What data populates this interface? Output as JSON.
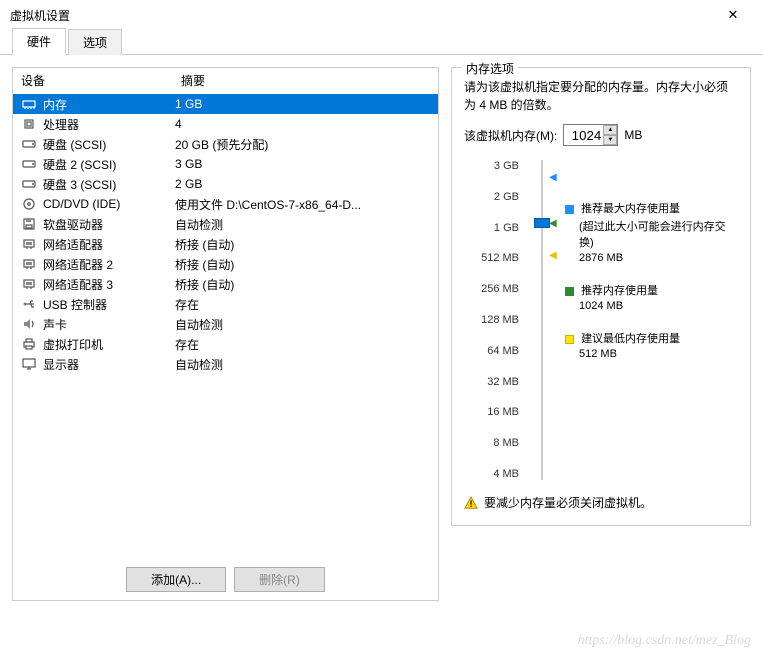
{
  "window": {
    "title": "虚拟机设置"
  },
  "tabs": {
    "hardware": "硬件",
    "options": "选项"
  },
  "headers": {
    "device": "设备",
    "summary": "摘要"
  },
  "devices": [
    {
      "name": "内存",
      "summary": "1 GB",
      "icon": "memory",
      "selected": true
    },
    {
      "name": "处理器",
      "summary": "4",
      "icon": "cpu"
    },
    {
      "name": "硬盘 (SCSI)",
      "summary": "20 GB (预先分配)",
      "icon": "disk"
    },
    {
      "name": "硬盘 2 (SCSI)",
      "summary": "3 GB",
      "icon": "disk"
    },
    {
      "name": "硬盘 3 (SCSI)",
      "summary": "2 GB",
      "icon": "disk"
    },
    {
      "name": "CD/DVD (IDE)",
      "summary": "使用文件 D:\\CentOS-7-x86_64-D...",
      "icon": "cd"
    },
    {
      "name": "软盘驱动器",
      "summary": "自动检测",
      "icon": "floppy"
    },
    {
      "name": "网络适配器",
      "summary": "桥接 (自动)",
      "icon": "net"
    },
    {
      "name": "网络适配器 2",
      "summary": "桥接 (自动)",
      "icon": "net"
    },
    {
      "name": "网络适配器 3",
      "summary": "桥接 (自动)",
      "icon": "net"
    },
    {
      "name": "USB 控制器",
      "summary": "存在",
      "icon": "usb"
    },
    {
      "name": "声卡",
      "summary": "自动检测",
      "icon": "sound"
    },
    {
      "name": "虚拟打印机",
      "summary": "存在",
      "icon": "printer"
    },
    {
      "name": "显示器",
      "summary": "自动检测",
      "icon": "display"
    }
  ],
  "memopt": {
    "title": "内存选项",
    "desc": "请为该虚拟机指定要分配的内存量。内存大小必须为 4 MB 的倍数。",
    "label": "该虚拟机内存(M):",
    "value": "1024",
    "unit": "MB",
    "ticks": [
      "3 GB",
      "2 GB",
      "1 GB",
      "512 MB",
      "256 MB",
      "128 MB",
      "64 MB",
      "32 MB",
      "16 MB",
      "8 MB",
      "4 MB"
    ],
    "legend": {
      "max": {
        "label": "推荐最大内存使用量",
        "note": "(超过此大小可能会进行内存交换)",
        "value": "2876 MB",
        "color": "#1e90ff"
      },
      "rec": {
        "label": "推荐内存使用量",
        "value": "1024 MB",
        "color": "#2e8b2e"
      },
      "min": {
        "label": "建议最低内存使用量",
        "value": "512 MB",
        "color": "#e6c200"
      }
    },
    "warn": "要减少内存量必须关闭虚拟机。"
  },
  "buttons": {
    "add": "添加(A)...",
    "remove": "删除(R)"
  },
  "watermark": "https://blog.csdn.net/mez_Blog"
}
